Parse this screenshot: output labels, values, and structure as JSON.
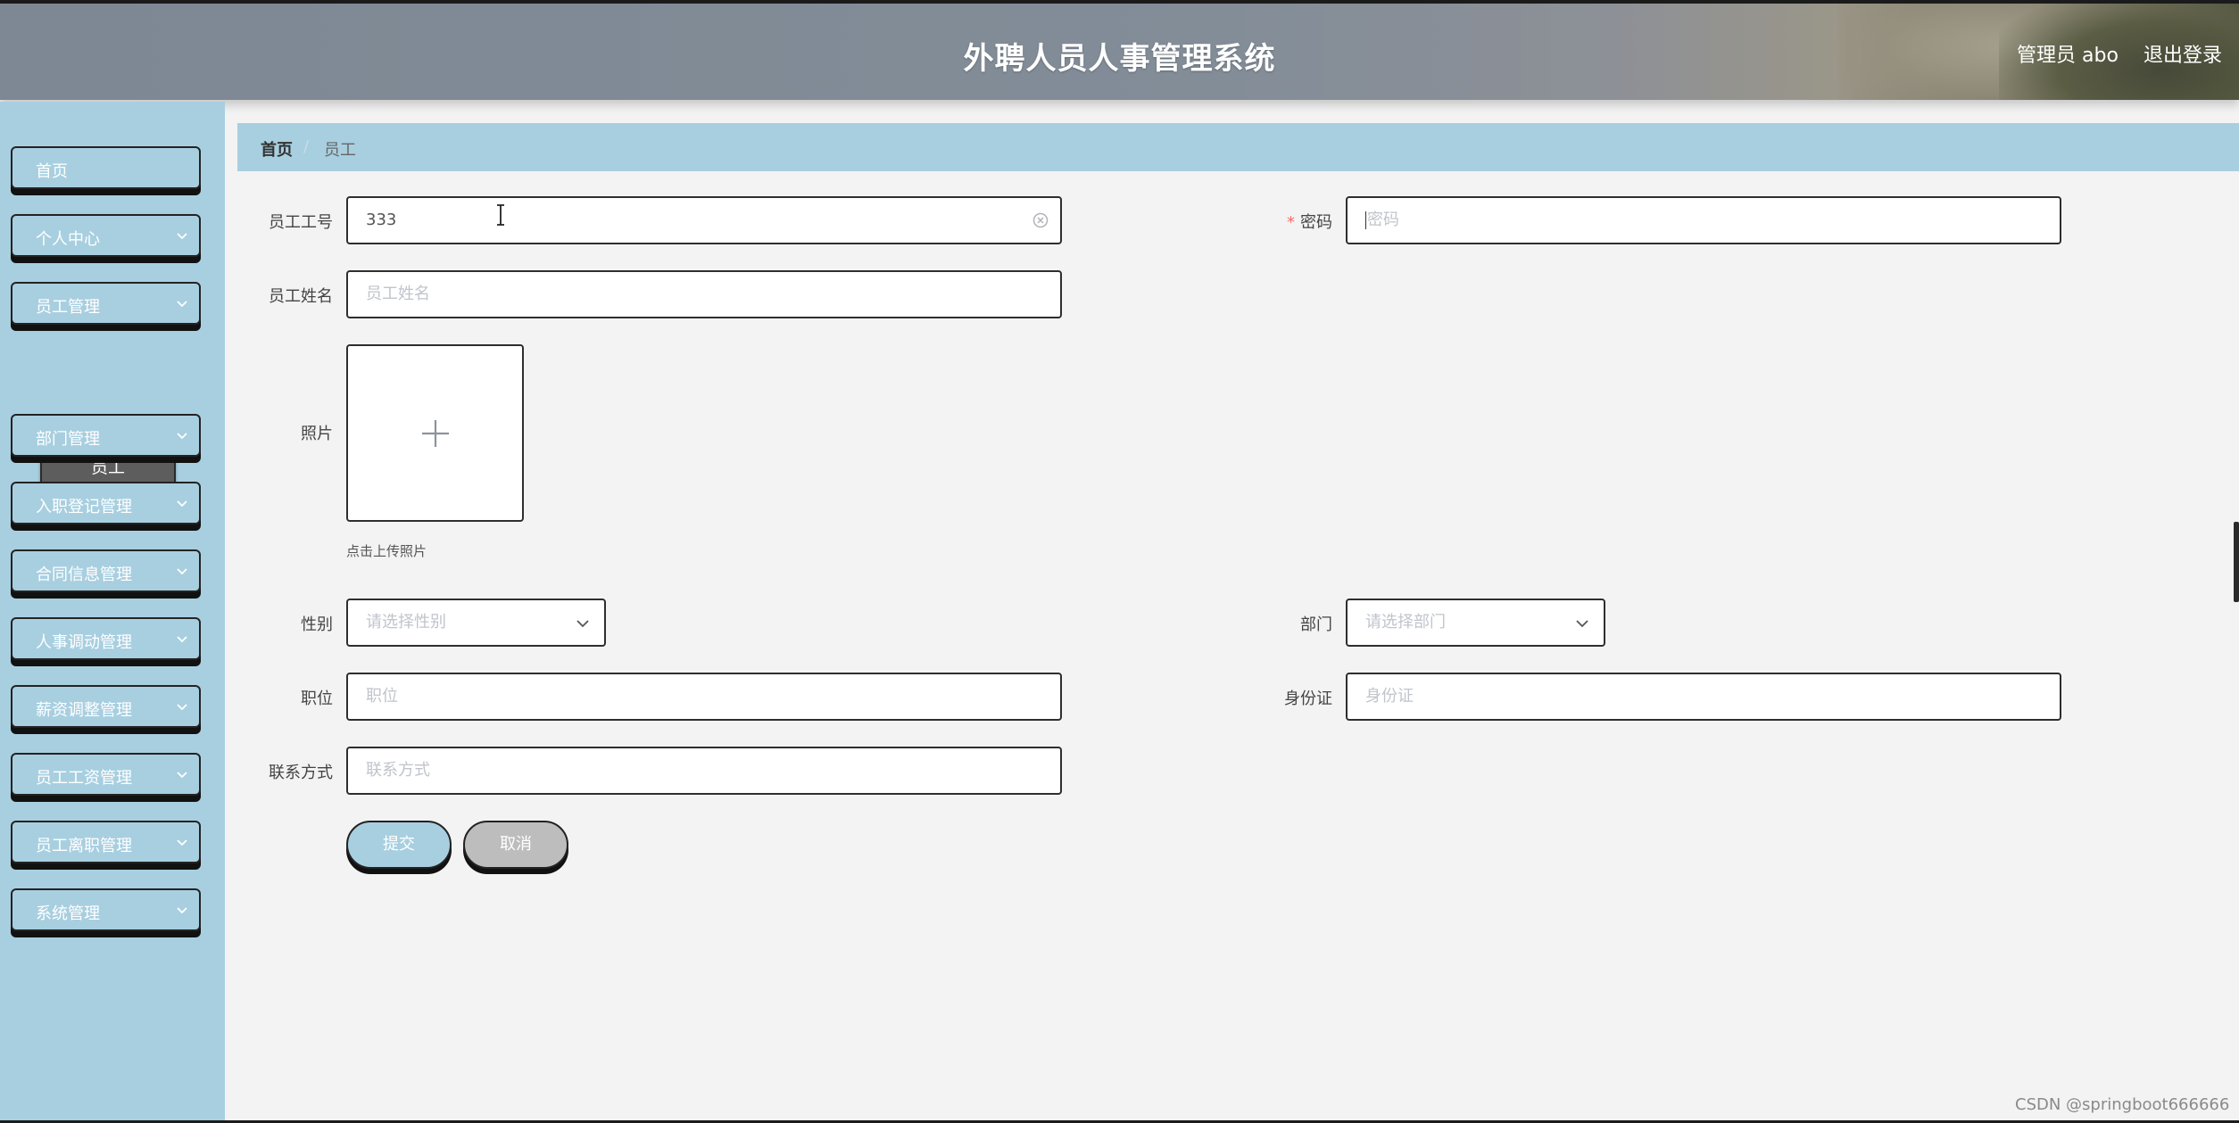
{
  "header": {
    "title": "外聘人员人事管理系统",
    "user_label": "管理员 abo",
    "logout_label": "退出登录"
  },
  "sidebar": {
    "items": [
      {
        "label": "首页",
        "has_arrow": false
      },
      {
        "label": "个人中心",
        "has_arrow": true
      },
      {
        "label": "员工管理",
        "has_arrow": true
      },
      {
        "label": "部门管理",
        "has_arrow": true
      },
      {
        "label": "入职登记管理",
        "has_arrow": true
      },
      {
        "label": "合同信息管理",
        "has_arrow": true
      },
      {
        "label": "人事调动管理",
        "has_arrow": true
      },
      {
        "label": "薪资调整管理",
        "has_arrow": true
      },
      {
        "label": "员工工资管理",
        "has_arrow": true
      },
      {
        "label": "员工离职管理",
        "has_arrow": true
      },
      {
        "label": "系统管理",
        "has_arrow": true
      }
    ],
    "active_submenu": "员工"
  },
  "breadcrumb": {
    "home": "首页",
    "separator": "/",
    "current": "员工"
  },
  "form": {
    "employee_no": {
      "label": "员工工号",
      "value": "333"
    },
    "password": {
      "label": "密码",
      "required_mark": "*",
      "placeholder": "密码"
    },
    "employee_name": {
      "label": "员工姓名",
      "placeholder": "员工姓名"
    },
    "photo": {
      "label": "照片",
      "tip": "点击上传照片"
    },
    "gender": {
      "label": "性别",
      "placeholder": "请选择性别"
    },
    "department": {
      "label": "部门",
      "placeholder": "请选择部门"
    },
    "position": {
      "label": "职位",
      "placeholder": "职位"
    },
    "id_card": {
      "label": "身份证",
      "placeholder": "身份证"
    },
    "contact": {
      "label": "联系方式",
      "placeholder": "联系方式"
    },
    "submit_label": "提交",
    "cancel_label": "取消"
  },
  "colors": {
    "sidebar_bg": "#a8cfe0",
    "header_bg": "#838d98",
    "submenu_bg": "#5d5d5d",
    "cancel_bg": "#bdbdbd",
    "required": "#f56c6c"
  },
  "watermark": "CSDN @springboot666666"
}
